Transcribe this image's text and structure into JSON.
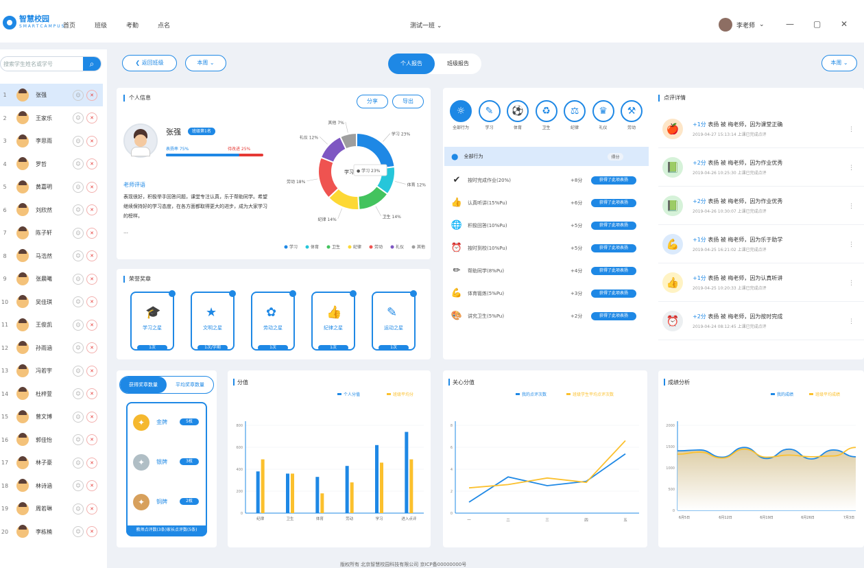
{
  "app": {
    "logo_title": "智慧校园",
    "logo_sub": "S M A R T C A M P U S"
  },
  "nav": [
    "首页",
    "班级",
    "考勤",
    "点名"
  ],
  "class_selector": "测试一班",
  "user_name": "李老师",
  "sidebar": {
    "search_placeholder": "搜索学生姓名或学号",
    "students": [
      {
        "rank": "1",
        "name": "张强"
      },
      {
        "rank": "2",
        "name": "王家乐"
      },
      {
        "rank": "3",
        "name": "李思雨"
      },
      {
        "rank": "4",
        "name": "罗哲"
      },
      {
        "rank": "5",
        "name": "黄嘉明"
      },
      {
        "rank": "6",
        "name": "刘欣然"
      },
      {
        "rank": "7",
        "name": "陈子轩"
      },
      {
        "rank": "8",
        "name": "马浩然"
      },
      {
        "rank": "9",
        "name": "张晨曦"
      },
      {
        "rank": "10",
        "name": "吴佳琪"
      },
      {
        "rank": "11",
        "name": "王俊凯"
      },
      {
        "rank": "12",
        "name": "孙雨涵"
      },
      {
        "rank": "13",
        "name": "冯若宇"
      },
      {
        "rank": "14",
        "name": "杜梓萱"
      },
      {
        "rank": "15",
        "name": "曾文博"
      },
      {
        "rank": "16",
        "name": "郭佳怡"
      },
      {
        "rank": "17",
        "name": "林子豪"
      },
      {
        "rank": "18",
        "name": "林诗涵"
      },
      {
        "rank": "19",
        "name": "周若琳"
      },
      {
        "rank": "20",
        "name": "李栋楠"
      }
    ]
  },
  "header": {
    "back": "返回班级",
    "term": "本周",
    "tab_personal": "个人报告",
    "tab_compare": "班级报告",
    "range": "本周"
  },
  "personal": {
    "title": "个人信息",
    "btn_share": "分享",
    "btn_export": "导出",
    "name": "张强",
    "badge": "班级第1名",
    "praise_label": "表扬率 75%",
    "criticize_label": "待改进 25%",
    "praise_pct": 75,
    "comment_title": "老师评语",
    "comment": "表现很好，积极举手回答问题，课堂专注认真，乐于帮助同学。希望继续保持好的学习态度，在各方面都取得更大的进步，成为大家学习的榜样。",
    "comment_more": "…"
  },
  "chart_data": [
    {
      "type": "pie",
      "labels": [
        "学习",
        "体育",
        "卫生",
        "纪律",
        "劳动",
        "礼仪",
        "其他"
      ],
      "values": [
        23,
        12,
        14,
        14,
        18,
        12,
        7
      ],
      "colors": [
        "#1e88e5",
        "#26c6da",
        "#43c35e",
        "#fdd835",
        "#ef5350",
        "#7e57c2",
        "#9e9e9e"
      ],
      "callouts": [
        "学习 23%",
        "体育 12%",
        "卫生 14%",
        "纪律 14%",
        "劳动 18%",
        "礼仪 12%",
        "其他 7%"
      ],
      "center_label": "学习",
      "tooltip": "● 学习 23%"
    },
    {
      "type": "bar",
      "title": "分值",
      "categories": [
        "纪律",
        "卫生",
        "体育",
        "劳动",
        "学习",
        "进入点评"
      ],
      "series": [
        {
          "name": "个人分值",
          "values": [
            380,
            360,
            330,
            430,
            620,
            740
          ],
          "color": "#1e88e5"
        },
        {
          "name": "班级平均分",
          "values": [
            490,
            360,
            180,
            280,
            460,
            490
          ],
          "color": "#fbc02d"
        }
      ],
      "ylim": [
        0,
        800
      ],
      "yticks": [
        "0",
        "200",
        "400",
        "600",
        "800"
      ]
    },
    {
      "type": "line",
      "title": "关心分值",
      "categories": [
        "一",
        "二",
        "三",
        "四",
        "五"
      ],
      "series": [
        {
          "name": "我的点评次数",
          "values": [
            1.0,
            3.3,
            2.5,
            2.9,
            5.4
          ],
          "color": "#1e88e5"
        },
        {
          "name": "班级学生平均点评次数",
          "values": [
            2.3,
            2.6,
            3.2,
            2.8,
            6.6
          ],
          "color": "#fbc02d"
        }
      ],
      "ylim": [
        0,
        8
      ],
      "yticks": [
        "0",
        "2",
        "4",
        "6",
        "8"
      ]
    },
    {
      "type": "area",
      "title": "成绩分析",
      "categories": [
        "6月5日",
        "6月12日",
        "6月19日",
        "6月26日",
        "7月3日"
      ],
      "series": [
        {
          "name": "我的成绩",
          "values": [
            1400,
            1420,
            1250,
            1480,
            1220,
            1440,
            1210,
            1420,
            1260
          ],
          "color": "#1e88e5"
        },
        {
          "name": "班级平均成绩",
          "values": [
            1320,
            1370,
            1230,
            1440,
            1250,
            1300,
            1260,
            1280,
            1480
          ],
          "color": "#fbc02d"
        }
      ],
      "ylim": [
        0,
        2000
      ],
      "yticks": [
        "0",
        "500",
        "1000",
        "1500",
        "2000"
      ]
    }
  ],
  "honors": {
    "title": "荣誉奖章",
    "items": [
      {
        "label": "学习之星",
        "foot": "1次"
      },
      {
        "label": "文明之星",
        "foot": "1次/学期"
      },
      {
        "label": "劳动之星",
        "foot": "1次"
      },
      {
        "label": "纪律之星",
        "foot": "1次"
      },
      {
        "label": "运动之星",
        "foot": "1次"
      }
    ]
  },
  "categories": {
    "items": [
      "全部行为",
      "学习",
      "体育",
      "卫生",
      "纪律",
      "礼仪",
      "劳动"
    ],
    "list_header": "全部行为",
    "list_header_tag": "得分",
    "behaviors": [
      {
        "icon": "✔",
        "text": "按时完成作业(20%)",
        "score": "+8分",
        "badge": "获得了此项表扬"
      },
      {
        "icon": "👍",
        "text": "认真听讲(15%Pu)",
        "score": "+6分",
        "badge": "获得了此项表扬"
      },
      {
        "icon": "🌐",
        "text": "积极回答(10%Pu)",
        "score": "+5分",
        "badge": "获得了此项表扬"
      },
      {
        "icon": "⏰",
        "text": "按时到校(10%Pu)",
        "score": "+5分",
        "badge": "获得了此项表扬"
      },
      {
        "icon": "✏",
        "text": "帮助同学(8%Pu)",
        "score": "+4分",
        "badge": "获得了此项表扬"
      },
      {
        "icon": "💪",
        "text": "体育锻炼(5%Pu)",
        "score": "+3分",
        "badge": "获得了此项表扬"
      },
      {
        "icon": "🎨",
        "text": "讲究卫生(5%Pu)",
        "score": "+2分",
        "badge": "获得了此项表扬"
      }
    ]
  },
  "records": {
    "title": "点评详情",
    "items": [
      {
        "icon": "🍎",
        "score": "+1分",
        "rest": " 表扬 被 梅老师，因为课堂正确",
        "time": "2019-04-27 15:13:14 上课已完成点评"
      },
      {
        "icon": "📗",
        "score": "+2分",
        "rest": " 表扬 被 梅老师，因为作业优秀",
        "time": "2019-04-26 10:25:30 上课已完成点评"
      },
      {
        "icon": "📗",
        "score": "+2分",
        "rest": " 表扬 被 梅老师，因为作业优秀",
        "time": "2019-04-26 10:30:07 上课已完成点评"
      },
      {
        "icon": "💪",
        "score": "+1分",
        "rest": " 表扬 被 梅老师，因为乐于助学",
        "time": "2019-04-25 16:21:02 上课已完成点评"
      },
      {
        "icon": "👍",
        "score": "+1分",
        "rest": " 表扬 被 梅老师，因为认真听讲",
        "time": "2019-04-25 10:20:33 上课已完成点评"
      },
      {
        "icon": "⏰",
        "score": "+2分",
        "rest": " 表扬 被 梅老师，因为按时完成",
        "time": "2019-04-24 08:12:45 上课已完成点评"
      }
    ]
  },
  "levels": {
    "tab_active": "获得奖章数量",
    "tab_other": "平均奖章数量",
    "items": [
      {
        "name": "金牌",
        "badge": "5枚",
        "color": "#f5b82e"
      },
      {
        "name": "银牌",
        "badge": "3枚",
        "color": "#b0bec5"
      },
      {
        "name": "铜牌",
        "badge": "2枚",
        "color": "#d7a05c"
      }
    ],
    "footer": "教师点评数(3条)家长点评数(5条)"
  },
  "footer": "版权所有 北京智慧校园科技有限公司 京ICP备00000000号"
}
